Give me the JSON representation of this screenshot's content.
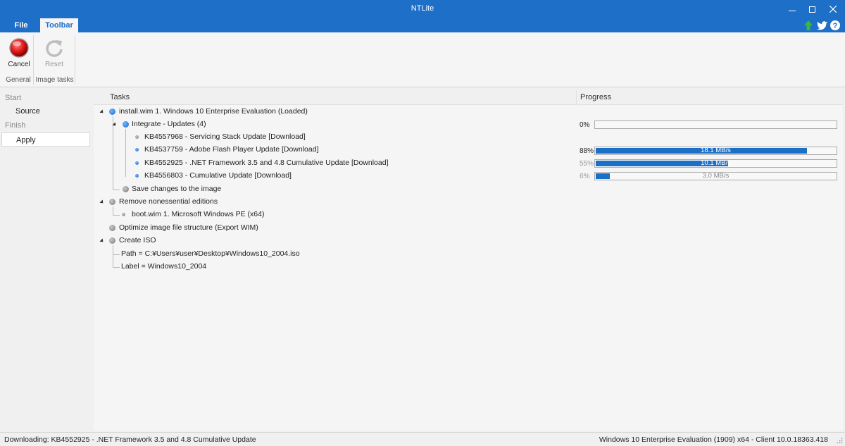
{
  "window": {
    "title": "NTLite"
  },
  "tabs": {
    "file": "File",
    "toolbar": "Toolbar"
  },
  "ribbon": {
    "cancel_label": "Cancel",
    "reset_label": "Reset",
    "group_general": "General",
    "group_image_tasks": "Image tasks"
  },
  "nav": {
    "start": "Start",
    "source": "Source",
    "finish": "Finish",
    "apply": "Apply"
  },
  "columns": {
    "tasks": "Tasks",
    "progress": "Progress"
  },
  "tasks": {
    "install_wim": "install.wim  1. Windows 10 Enterprise Evaluation  (Loaded)",
    "integrate": "Integrate - Updates (4)",
    "kb1": "KB4557968 - Servicing Stack Update [Download]",
    "kb2": "KB4537759 - Adobe Flash Player Update [Download]",
    "kb3": "KB4552925 - .NET Framework 3.5 and 4.8 Cumulative Update [Download]",
    "kb4": "KB4556803 - Cumulative Update [Download]",
    "save_changes": "Save changes to the image",
    "remove_editions": "Remove nonessential editions",
    "boot_wim": "boot.wim  1. Microsoft Windows PE (x64)",
    "optimize": "Optimize image file structure (Export WIM)",
    "create_iso": "Create ISO",
    "iso_path": "Path = C:¥Users¥user¥Desktop¥Windows10_2004.iso",
    "iso_label": "Label = Windows10_2004"
  },
  "progress": {
    "integrate": {
      "percent": "0%",
      "value": 0,
      "speed": ""
    },
    "kb2": {
      "percent": "88%",
      "value": 0.88,
      "speed": "18.1 MB/s"
    },
    "kb3": {
      "percent": "55%",
      "value": 0.55,
      "speed": "10.1 MB/s"
    },
    "kb4": {
      "percent": "6%",
      "value": 0.06,
      "speed": "3.0 MB/s"
    }
  },
  "status": {
    "left": "Downloading: KB4552925 - .NET Framework 3.5 and 4.8 Cumulative Update",
    "right": "Windows 10 Enterprise Evaluation (1909) x64 - Client 10.0.18363.418"
  },
  "colors": {
    "accent": "#1e6fc8",
    "progress_fill": "#1a70c8",
    "cancel_red": "#d01818"
  },
  "icons": {
    "cancel": "red-stop-icon",
    "reset": "refresh-icon",
    "update": "green-up-arrow-icon",
    "twitter": "twitter-icon",
    "help": "help-icon"
  }
}
